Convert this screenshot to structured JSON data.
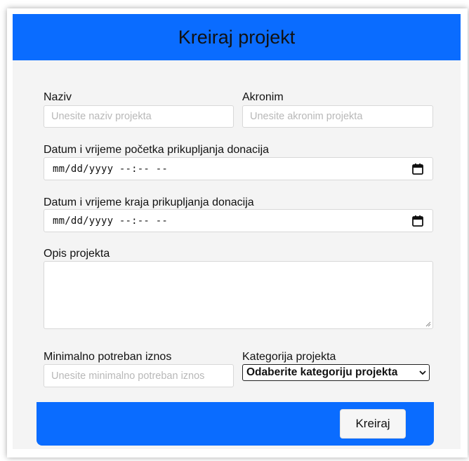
{
  "form": {
    "title": "Kreiraj projekt",
    "naziv": {
      "label": "Naziv",
      "placeholder": "Unesite naziv projekta"
    },
    "akronim": {
      "label": "Akronim",
      "placeholder": "Unesite akronim projekta"
    },
    "start": {
      "label": "Datum i vrijeme početka prikupljanja donacija",
      "value": "mm/dd/yyyy --:-- --"
    },
    "end": {
      "label": "Datum i vrijeme kraja prikupljanja donacija",
      "value": "mm/dd/yyyy --:-- --"
    },
    "opis": {
      "label": "Opis projekta"
    },
    "iznos": {
      "label": "Minimalno potreban iznos",
      "placeholder": "Unesite minimalno potreban iznos"
    },
    "kategorija": {
      "label": "Kategorija projekta",
      "selected": "Odaberite kategoriju projekta"
    },
    "submit_label": "Kreiraj"
  },
  "colors": {
    "accent": "#0a6cff",
    "panel": "#f4f4f4"
  },
  "icons": {
    "calendar": "calendar-icon",
    "dropdown": "chevron-down-icon",
    "resize": "resize-grip-icon"
  }
}
